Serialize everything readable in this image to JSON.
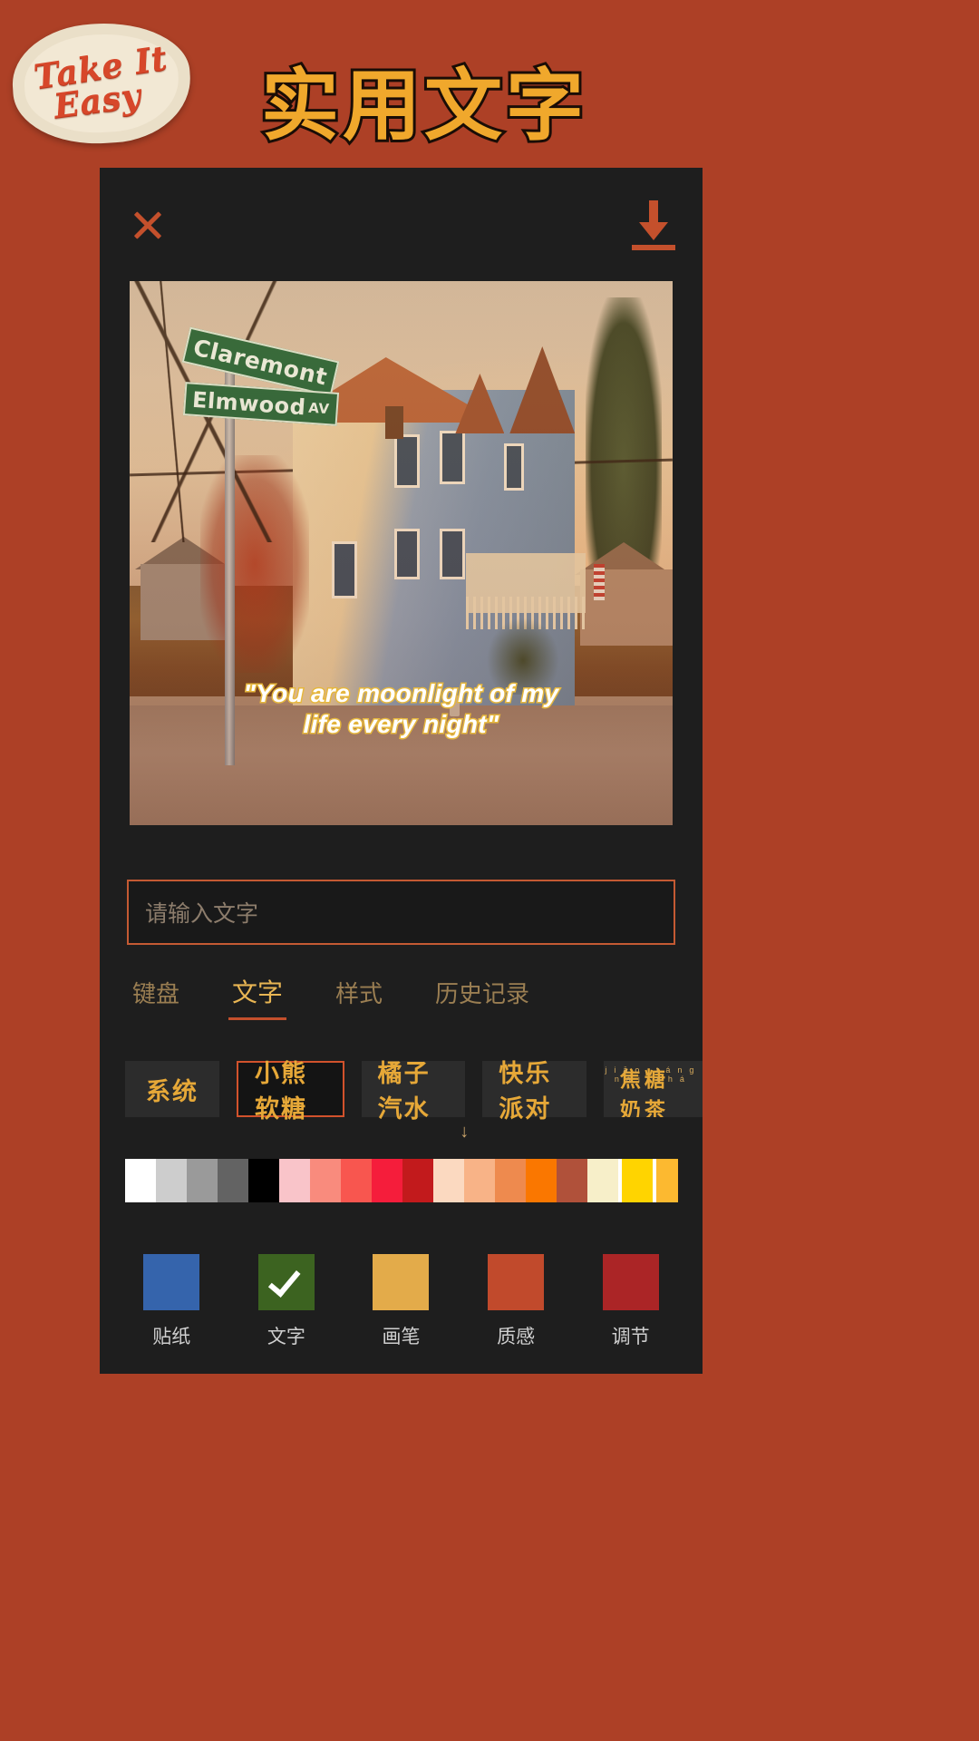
{
  "header": {
    "sticker_line1": "Take It",
    "sticker_line2": "Easy",
    "sticker_name": "take-it-easy-patch",
    "title": "实用文字",
    "bg_color": "#ad4026",
    "title_color": "#f0a82c"
  },
  "toolbar": {
    "close_icon": "close-icon",
    "download_icon": "download-icon",
    "accent_color": "#c4502c"
  },
  "photo": {
    "street_sign_1": "Claremont",
    "street_sign_2": "Elmwood",
    "street_sign_2_suffix": "AV",
    "caption_line1": "\"You are moonlight of my",
    "caption_line2": "life every night\"",
    "caption_color": "#ffffff",
    "caption_outline_color": "#e6b73d"
  },
  "input": {
    "value": "",
    "placeholder": "请输入文字",
    "border_color": "#c45a33"
  },
  "tabs": [
    {
      "label": "键盘",
      "active": false
    },
    {
      "label": "文字",
      "active": true
    },
    {
      "label": "样式",
      "active": false
    },
    {
      "label": "历史记录",
      "active": false
    }
  ],
  "fonts": [
    {
      "label": "系统",
      "selected": false,
      "downloadable": false,
      "pinyin": ""
    },
    {
      "label": "小熊软糖",
      "selected": true,
      "downloadable": false,
      "pinyin": ""
    },
    {
      "label": "橘子汽水",
      "selected": false,
      "downloadable": true,
      "pinyin": ""
    },
    {
      "label": "快乐派对",
      "selected": false,
      "downloadable": false,
      "pinyin": ""
    },
    {
      "label": "焦糖奶茶",
      "selected": false,
      "downloadable": true,
      "pinyin": "jiāo táng nǎi chá"
    }
  ],
  "palette": {
    "selected_index": 19,
    "selected_color": "#ffd400",
    "colors": [
      "#ffffff",
      "#cdcdcd",
      "#9a9a9a",
      "#636363",
      "#000000",
      "#f9c4c9",
      "#f98b7d",
      "#f8564f",
      "#f51d3b",
      "#c21a1c",
      "#fbd9c0",
      "#f8b387",
      "#ee8a4e",
      "#fa7700",
      "#b0513a",
      "#f7efc9",
      "#ffd400",
      "#fcb930"
    ]
  },
  "bottom_nav": [
    {
      "label": "贴纸",
      "color": "#3564ac",
      "active": false,
      "icon": "sticker-swatch"
    },
    {
      "label": "文字",
      "color": "#3c6320",
      "active": true,
      "icon": "check-icon"
    },
    {
      "label": "画笔",
      "color": "#e3ab4a",
      "active": false,
      "icon": "brush-swatch"
    },
    {
      "label": "质感",
      "color": "#c14a2c",
      "active": false,
      "icon": "texture-swatch"
    },
    {
      "label": "调节",
      "color": "#ab2526",
      "active": false,
      "icon": "adjust-swatch"
    }
  ]
}
